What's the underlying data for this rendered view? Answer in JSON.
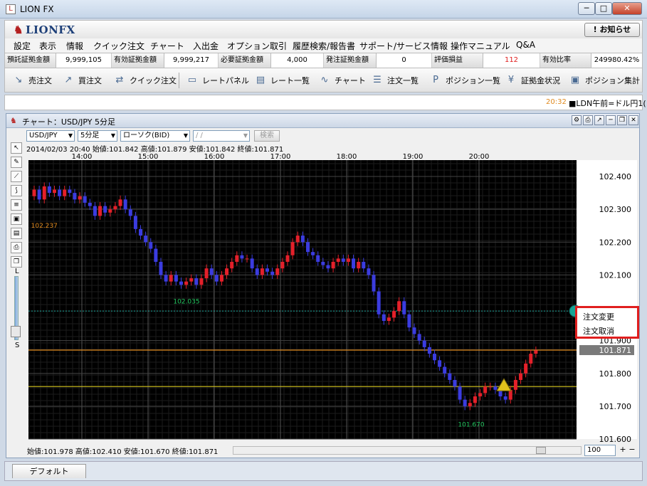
{
  "window": {
    "title": "LION FX",
    "min": "─",
    "max": "□",
    "close": "✕"
  },
  "brand": {
    "logo": "LIONFX",
    "notice_button": "! お知らせ"
  },
  "menu": [
    "設定",
    "表示",
    "情報",
    "クイック注文",
    "チャート",
    "入出金",
    "オプション取引",
    "履歴検索/報告書",
    "サポート/サービス情報",
    "操作マニュアル",
    "Q&A"
  ],
  "account": [
    {
      "label": "預託証拠金額",
      "value": "9,999,105"
    },
    {
      "label": "有効証拠金額",
      "value": "9,999,217"
    },
    {
      "label": "必要証拠金額",
      "value": "4,000"
    },
    {
      "label": "発注証拠金額",
      "value": "0"
    },
    {
      "label": "評価損益",
      "value": "112"
    },
    {
      "label": "有効比率",
      "value": "249980.42%"
    }
  ],
  "toolbar": [
    {
      "icon": "sell-arrow-icon",
      "label": "売注文"
    },
    {
      "icon": "buy-arrow-icon",
      "label": "買注文"
    },
    {
      "icon": "quick-order-icon",
      "label": "クイック注文"
    },
    {
      "icon": "rate-panel-icon",
      "label": "レートパネル"
    },
    {
      "icon": "rate-list-icon",
      "label": "レート一覧"
    },
    {
      "icon": "chart-icon",
      "label": "チャート"
    },
    {
      "icon": "order-list-icon",
      "label": "注文一覧"
    },
    {
      "icon": "position-icon",
      "label": "ポジション一覧"
    },
    {
      "icon": "margin-status-icon",
      "label": "証拠金状況"
    },
    {
      "icon": "position-summary-icon",
      "label": "ポジション集計"
    }
  ],
  "ticker": {
    "time": "20:32",
    "text": "■LDN午前=ドル円1("
  },
  "chart_window": {
    "title": "チャート：USD/JPY 5分足",
    "pair": "USD/JPY",
    "interval": "5分足",
    "candle_type": "ローソク(BID)",
    "date_placeholder": "/ /",
    "search": "検索",
    "ohlc_top": "2014/02/03 20:40  始値:101.842  高値:101.879  安値:101.842  終値:101.871",
    "ohlc_bottom": "始値:101.978    高値:102.410    安値:101.670    終値:101.871",
    "zoom_value": "100",
    "zoom_L": "L",
    "zoom_S": "S"
  },
  "context_menu": {
    "item1": "注文変更",
    "item2": "注文取消"
  },
  "statusbar": {
    "tab": "デフォルト"
  },
  "colors": {
    "up": "#e4202a",
    "down": "#3b3ce0",
    "bg": "#000000",
    "current_price": "#e08a1e",
    "order_line": "#d4c41e",
    "dotted_line": "#1fa69b"
  },
  "chart_data": {
    "type": "candlestick",
    "x_ticks": [
      "14:00",
      "15:00",
      "16:00",
      "17:00",
      "18:00",
      "19:00",
      "20:00"
    ],
    "y_ticks": [
      "102.400",
      "102.300",
      "102.200",
      "102.100",
      "101.900",
      "101.800",
      "101.700",
      "101.600"
    ],
    "ylim": [
      101.6,
      102.45
    ],
    "current_price_label": "101.871",
    "current_price": 101.871,
    "order_price": 101.76,
    "stop_price": 101.99,
    "high_annotation": "102.237",
    "high_value": 102.237,
    "low_annotation_1": "102.035",
    "low_value_1": 102.035,
    "low_annotation_2": "101.670",
    "low_value_2": 101.67,
    "closes": [
      102.36,
      102.33,
      102.37,
      102.35,
      102.36,
      102.34,
      102.36,
      102.35,
      102.33,
      102.34,
      102.32,
      102.31,
      102.28,
      102.31,
      102.29,
      102.3,
      102.31,
      102.33,
      102.3,
      102.28,
      102.24,
      102.22,
      102.2,
      102.18,
      102.14,
      102.1,
      102.08,
      102.1,
      102.08,
      102.07,
      102.08,
      102.09,
      102.07,
      102.09,
      102.12,
      102.1,
      102.08,
      102.1,
      102.12,
      102.14,
      102.16,
      102.15,
      102.15,
      102.12,
      102.1,
      102.12,
      102.11,
      102.1,
      102.12,
      102.14,
      102.16,
      102.2,
      102.22,
      102.2,
      102.17,
      102.16,
      102.14,
      102.13,
      102.12,
      102.14,
      102.15,
      102.14,
      102.15,
      102.12,
      102.14,
      102.12,
      102.1,
      102.05,
      101.98,
      101.96,
      101.97,
      101.99,
      102.02,
      101.98,
      101.94,
      101.92,
      101.9,
      101.88,
      101.86,
      101.84,
      101.82,
      101.8,
      101.78,
      101.76,
      101.72,
      101.7,
      101.71,
      101.73,
      101.74,
      101.76,
      101.76,
      101.75,
      101.73,
      101.72,
      101.75,
      101.78,
      101.8,
      101.83,
      101.86,
      101.87
    ]
  }
}
